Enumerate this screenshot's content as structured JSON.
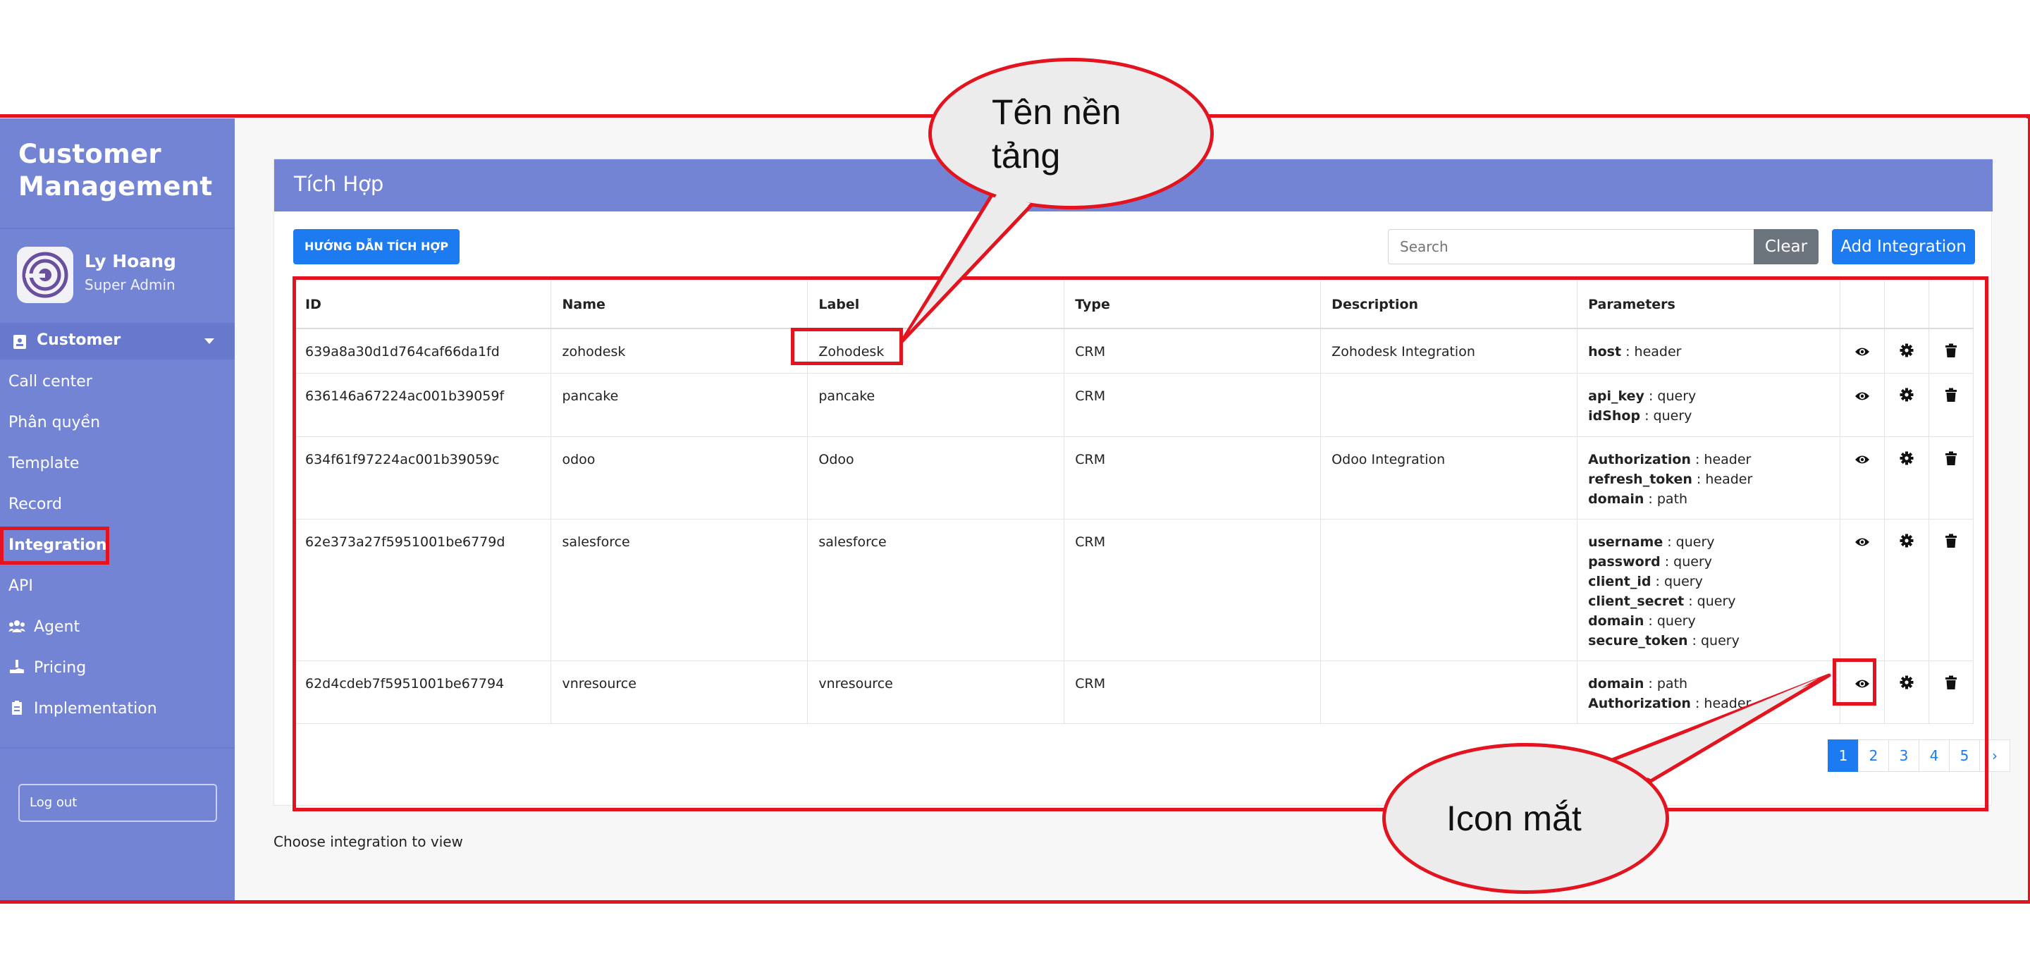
{
  "app": {
    "brand_line1": "Customer",
    "brand_line2": "Management",
    "close_symbol": "×"
  },
  "user": {
    "name": "Ly Hoang",
    "role": "Super Admin"
  },
  "sidebar": {
    "group_label": "Customer",
    "items": [
      {
        "label": "Call center"
      },
      {
        "label": "Phân quyền"
      },
      {
        "label": "Template"
      },
      {
        "label": "Record"
      },
      {
        "label": "Integration"
      },
      {
        "label": "API"
      },
      {
        "label": "Agent",
        "icon": "users-icon"
      },
      {
        "label": "Pricing",
        "icon": "hand-money-icon"
      },
      {
        "label": "Implementation",
        "icon": "clipboard-icon"
      }
    ],
    "logout_label": "Log out"
  },
  "page": {
    "title": "Tích Hợp",
    "guide_button": "HƯỚNG DẪN TÍCH HỢP",
    "search_placeholder": "Search",
    "clear_button": "Clear",
    "add_button": "Add Integration",
    "choose_text": "Choose integration to view"
  },
  "table": {
    "headers": [
      "ID",
      "Name",
      "Label",
      "Type",
      "Description",
      "Parameters"
    ],
    "rows": [
      {
        "id": "639a8a30d1d764caf66da1fd",
        "name": "zohodesk",
        "label": "Zohodesk",
        "type": "CRM",
        "description": "Zohodesk Integration",
        "params": [
          {
            "key": "host",
            "value": " : header"
          }
        ]
      },
      {
        "id": "636146a67224ac001b39059f",
        "name": "pancake",
        "label": "pancake",
        "type": "CRM",
        "description": "",
        "params": [
          {
            "key": "api_key",
            "value": " : query"
          },
          {
            "key": "idShop",
            "value": " : query"
          }
        ]
      },
      {
        "id": "634f61f97224ac001b39059c",
        "name": "odoo",
        "label": "Odoo",
        "type": "CRM",
        "description": "Odoo Integration",
        "params": [
          {
            "key": "Authorization",
            "value": " : header"
          },
          {
            "key": "refresh_token",
            "value": " : header"
          },
          {
            "key": "domain",
            "value": " : path"
          }
        ]
      },
      {
        "id": "62e373a27f5951001be6779d",
        "name": "salesforce",
        "label": "salesforce",
        "type": "CRM",
        "description": "",
        "params": [
          {
            "key": "username",
            "value": " : query"
          },
          {
            "key": "password",
            "value": " : query"
          },
          {
            "key": "client_id",
            "value": " : query"
          },
          {
            "key": "client_secret",
            "value": " : query"
          },
          {
            "key": "domain",
            "value": " : query"
          },
          {
            "key": "secure_token",
            "value": " : query"
          }
        ]
      },
      {
        "id": "62d4cdeb7f5951001be67794",
        "name": "vnresource",
        "label": "vnresource",
        "type": "CRM",
        "description": "",
        "params": [
          {
            "key": "domain",
            "value": " : path"
          },
          {
            "key": "Authorization",
            "value": " : header"
          }
        ]
      }
    ],
    "row_icons": [
      "eye-icon",
      "gear-icon",
      "trash-icon"
    ]
  },
  "pagination": {
    "pages": [
      "1",
      "2",
      "3",
      "4",
      "5"
    ],
    "next": "›",
    "active": "1"
  },
  "annotations": {
    "bubble_platform_line1": "Tên nền",
    "bubble_platform_line2": "tảng",
    "bubble_eye": "Icon mắt"
  },
  "colors": {
    "sidebar": "#7484d4",
    "primary": "#1d7bf2",
    "annotation": "#e3141f",
    "clear": "#6c757d"
  }
}
